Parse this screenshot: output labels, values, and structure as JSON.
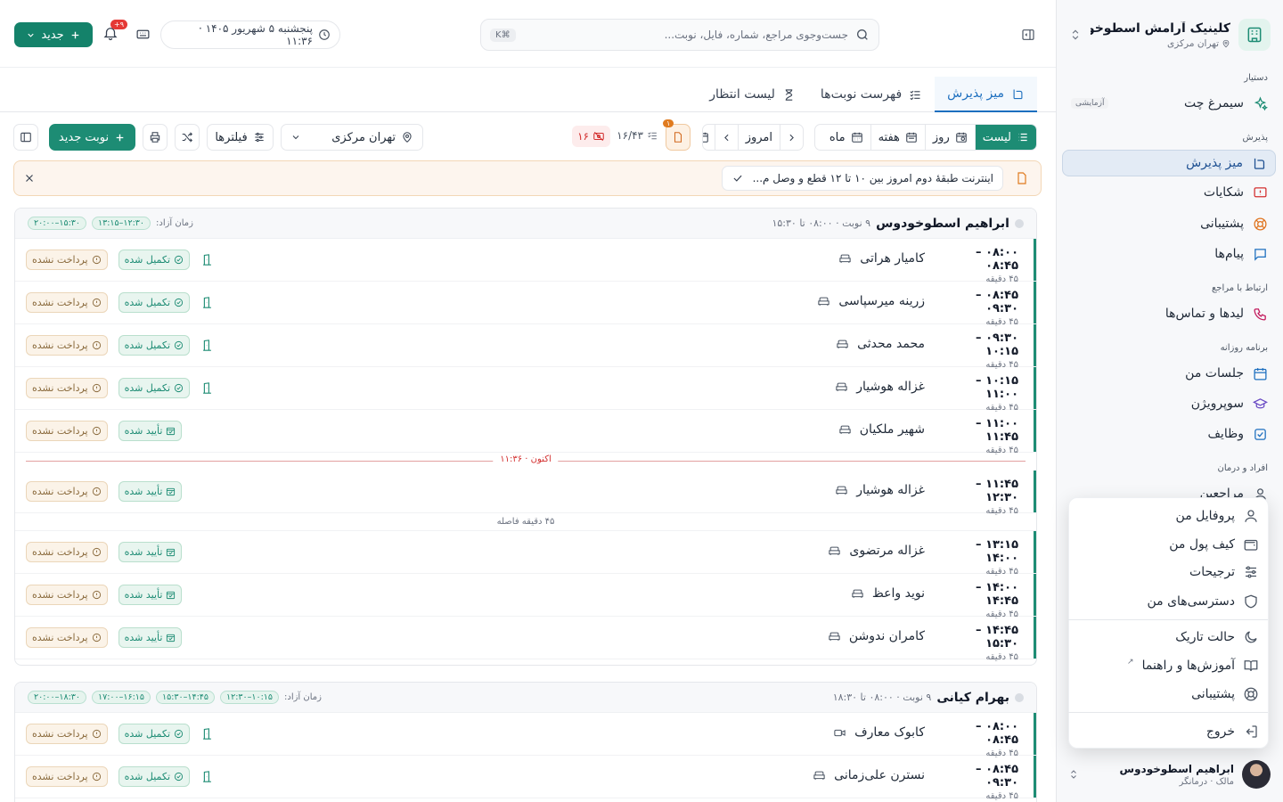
{
  "brand": {
    "name": "کلینیک آرامش اسطوخو...",
    "location": "تهران مرکزی"
  },
  "sidebar": {
    "sections": [
      {
        "title": "دستیار",
        "items": [
          {
            "label": "سیمرغ چت",
            "badge": "آزمایشی",
            "icon": "sparkles-icon"
          }
        ]
      },
      {
        "title": "پذیرش",
        "items": [
          {
            "label": "میز پذیرش",
            "icon": "desk-bell-icon",
            "active": true
          },
          {
            "label": "شکایات",
            "icon": "alert-message-icon"
          },
          {
            "label": "پشتیبانی",
            "icon": "lifebuoy-icon"
          },
          {
            "label": "پیام‌ها",
            "icon": "message-icon"
          }
        ]
      },
      {
        "title": "ارتباط با مراجع",
        "items": [
          {
            "label": "لیدها و تماس‌ها",
            "icon": "phone-call-icon"
          }
        ]
      },
      {
        "title": "برنامه روزانه",
        "items": [
          {
            "label": "جلسات من",
            "icon": "calendar-icon"
          },
          {
            "label": "سوپرویژن",
            "icon": "graduation-cap-icon"
          },
          {
            "label": "وظایف",
            "icon": "checkbox-icon"
          }
        ]
      },
      {
        "title": "افراد و درمان",
        "items": [
          {
            "label": "مراجعین",
            "icon": "user-icon"
          }
        ]
      }
    ]
  },
  "user_menu": {
    "items": [
      {
        "label": "پروفایل من",
        "icon": "user-icon"
      },
      {
        "label": "کیف پول من",
        "icon": "wallet-icon"
      },
      {
        "label": "ترجیحات",
        "icon": "sliders-icon"
      },
      {
        "label": "دسترسی‌های من",
        "icon": "shield-icon"
      },
      {
        "label": "حالت تاریک",
        "icon": "moon-icon"
      },
      {
        "label": "آموزش‌ها و راهنما",
        "icon": "book-icon"
      },
      {
        "label": "پشتیبانی",
        "icon": "lifebuoy-icon"
      },
      {
        "label": "خروج",
        "icon": "logout-icon"
      }
    ]
  },
  "user": {
    "name": "ابراهیم اسطوخودوس",
    "role": "مالک · درمانگر"
  },
  "topbar": {
    "search_placeholder": "جست‌وجوی مراجع، شماره، فایل، نوبت...",
    "search_shortcut": "⌘K",
    "datetime": "پنجشنبه ۵ شهریور ۱۴۰۵ · ۱۱:۳۶",
    "notif_count": "۹+",
    "new_label": "جدید"
  },
  "tabs": [
    {
      "label": "میز پذیرش",
      "active": true
    },
    {
      "label": "فهرست نوبت‌ها"
    },
    {
      "label": "لیست انتظار"
    }
  ],
  "toolbar": {
    "views": [
      "لیست",
      "روز",
      "هفته",
      "ماه"
    ],
    "today": "امروز",
    "count": "۱۶/۴۳",
    "red_count": "۱۶",
    "doc_badge": "۱",
    "location": "تهران مرکزی",
    "filters": "فیلترها",
    "new_appt": "نوبت جدید"
  },
  "banner": {
    "text": "اینترنت طبقهٔ دوم امروز بین ۱۰ تا ۱۲ قطع و وصل م..."
  },
  "labels": {
    "free_time": "زمان آزاد:",
    "duration": "۴۵ دقیقه",
    "unpaid": "پرداخت نشده",
    "completed": "تکمیل شده",
    "confirmed": "تأیید شده",
    "now": "اکنون · ۱۱:۳۶",
    "gap": "۴۵ دقیقه فاصله"
  },
  "providers": [
    {
      "name": "ابراهیم اسطوخودوس",
      "meta": "۹ نوبت · ۰۸:۰۰ تا ۱۵:۳۰",
      "free": [
        "۱۲:۳۰–۱۳:۱۵",
        "۱۵:۳۰–۲۰:۰۰"
      ],
      "rows": [
        {
          "time": "۰۸:۰۰ – ۰۸:۴۵",
          "client": "کامیار هراتی",
          "status": "completed"
        },
        {
          "time": "۰۸:۴۵ – ۰۹:۳۰",
          "client": "زرینه میرسپاسی",
          "status": "completed"
        },
        {
          "time": "۰۹:۳۰ – ۱۰:۱۵",
          "client": "محمد محدثی",
          "status": "completed"
        },
        {
          "time": "۱۰:۱۵ – ۱۱:۰۰",
          "client": "غزاله هوشیار",
          "status": "completed"
        },
        {
          "time": "۱۱:۰۰ – ۱۱:۴۵",
          "client": "شهیر ملکیان",
          "status": "confirmed"
        },
        {
          "time": "۱۱:۴۵ – ۱۲:۳۰",
          "client": "غزاله هوشیار",
          "status": "confirmed"
        },
        {
          "time": "۱۳:۱۵ – ۱۴:۰۰",
          "client": "غزاله مرتضوی",
          "status": "confirmed"
        },
        {
          "time": "۱۴:۰۰ – ۱۴:۴۵",
          "client": "نوید واعظ",
          "status": "confirmed"
        },
        {
          "time": "۱۴:۴۵ – ۱۵:۳۰",
          "client": "کامران ندوشن",
          "status": "confirmed"
        }
      ]
    },
    {
      "name": "بهرام کیانی",
      "meta": "۹ نوبت · ۰۸:۰۰ تا ۱۸:۳۰",
      "free": [
        "۱۰:۱۵–۱۲:۳۰",
        "۱۴:۴۵–۱۵:۳۰",
        "۱۶:۱۵–۱۷:۰۰",
        "۱۸:۳۰–۲۰:۰۰"
      ],
      "rows": [
        {
          "time": "۰۸:۰۰ – ۰۸:۴۵",
          "client": "کابوک معارف",
          "status": "completed",
          "video": true
        },
        {
          "time": "۰۸:۴۵ – ۰۹:۳۰",
          "client": "نسترن علی‌زمانی",
          "status": "completed"
        }
      ]
    }
  ],
  "colors": {
    "accent": "#1d8c74",
    "active_tab": "#1d6fbf",
    "danger": "#d32f2f"
  }
}
